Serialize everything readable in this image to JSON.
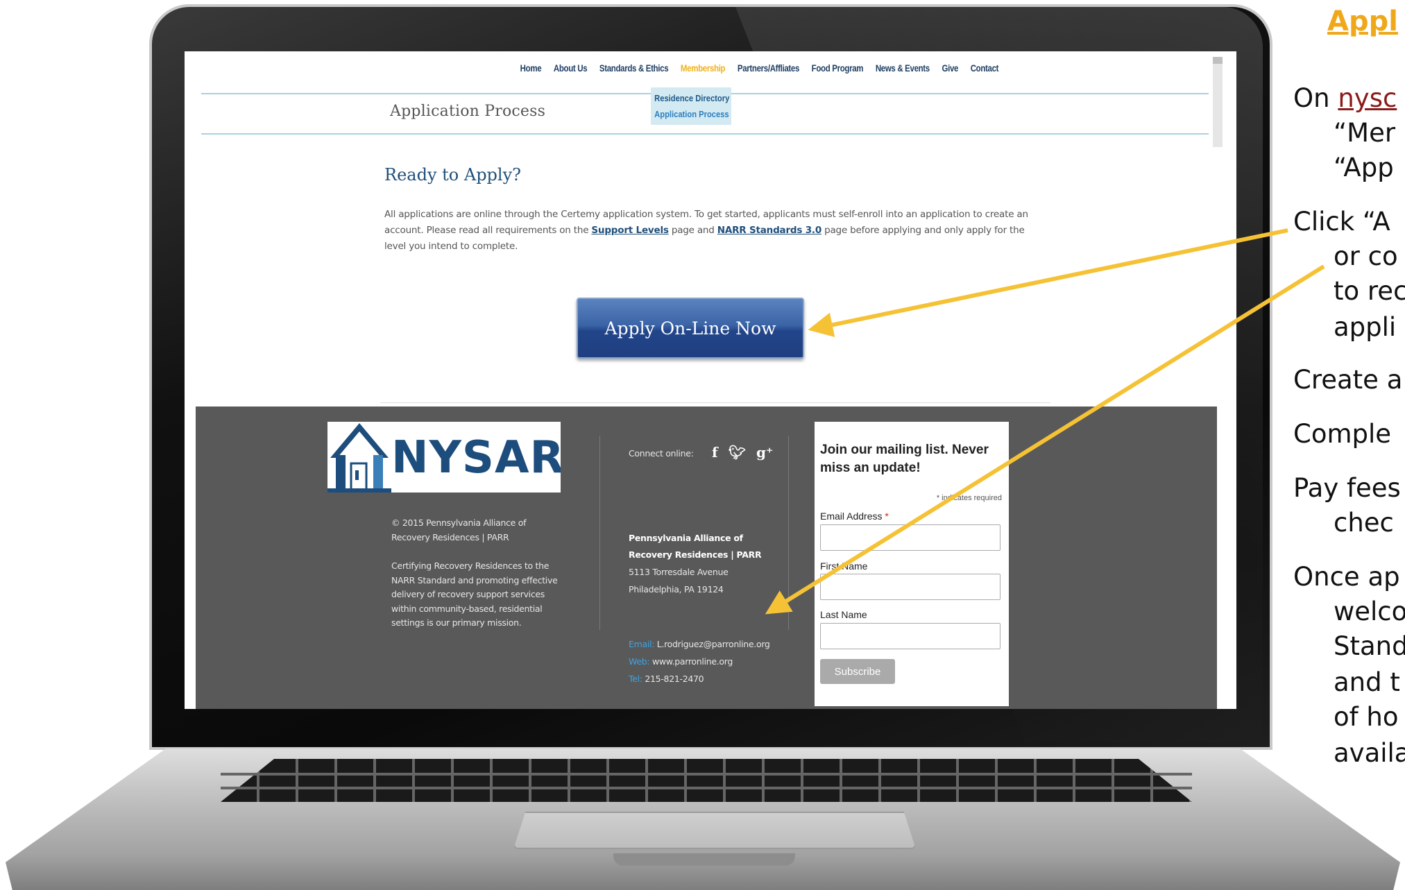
{
  "site": {
    "nav": [
      "Home",
      "About Us",
      "Standards & Ethics",
      "Membership",
      "Partners/Affliates",
      "Food Program",
      "News & Events",
      "Give",
      "Contact"
    ],
    "active_nav": "Membership",
    "submenu": [
      "Residence Directory",
      "Application Process"
    ],
    "page_heading": "Application Process",
    "ready_title": "Ready to Apply?",
    "intro": {
      "part1": "All applications are online through the Certemy application system. To get started, applicants must self-enroll into an application to create an account. Please read all requirements on the ",
      "link1": "Support Levels",
      "part2": " page and ",
      "link2": "NARR Standards 3.0",
      "part3": " page before applying and only apply for the level you intend to complete."
    },
    "apply_button": "Apply On-Line Now"
  },
  "footer": {
    "logo_text": "NYSARR",
    "copyright": "© 2015 Pennsylvania Alliance of Recovery Residences | PARR",
    "mission": "Certifying Recovery Residences to the NARR Standard and promoting effective delivery of recovery support services within community-based, residential settings is our primary mission.",
    "connect_label": "Connect online:",
    "social_icons": [
      "facebook-icon",
      "twitter-icon",
      "googleplus-icon"
    ],
    "org_name": "Pennsylvania Alliance of Recovery Residences | PARR",
    "address_line1": "5113 Torresdale Avenue",
    "address_line2": "Philadelphia, PA 19124",
    "email_key": "Email:",
    "email_value": "L.rodriguez@parronline.org",
    "web_key": "Web:",
    "web_value": "www.parronline.org",
    "tel_key": "Tel:",
    "tel_value": "215-821-2470"
  },
  "signup": {
    "title": "Join our mailing list. Never miss an update!",
    "required_note": "* indicates required",
    "email_label": "Email Address",
    "first_label": "First Name",
    "last_label": "Last Name",
    "subscribe": "Subscribe"
  },
  "slide": {
    "title": "Appl",
    "line1_prefix": "On ",
    "line1_link": "nysc",
    "line2": "“Mer",
    "line3": "“App",
    "line4": "Click “A",
    "line5": "or co",
    "line6": "to rec",
    "line7": "appli",
    "line8": "Create a",
    "line9": "Comple",
    "line10": "Pay fees",
    "line11": "chec",
    "line12": "Once ap",
    "line13": "welco",
    "line14": "Stand",
    "line15": "and t",
    "line16": "of ho",
    "line17": "availa"
  },
  "colors": {
    "accent": "#f0b21b",
    "arrow": "#f5c236",
    "nav_text": "#1f3f63",
    "footer_bg": "#595959",
    "button_blue": "#22458a"
  }
}
